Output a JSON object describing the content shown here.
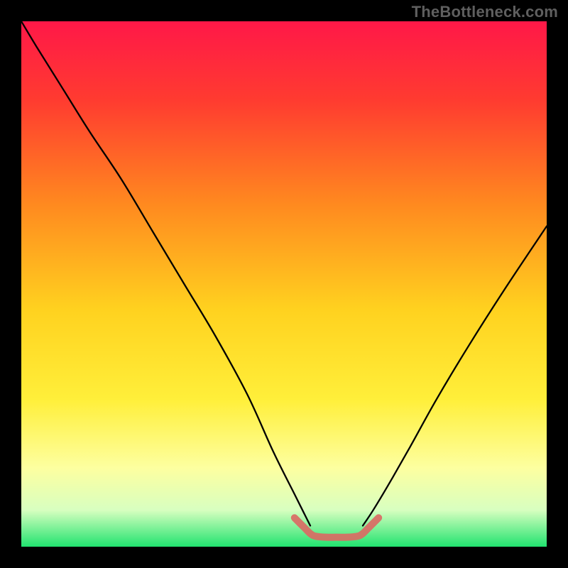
{
  "watermark": {
    "text": "TheBottleneck.com"
  },
  "chart_data": {
    "type": "line",
    "title": "",
    "xlabel": "",
    "ylabel": "",
    "xlim": [
      0,
      100
    ],
    "ylim": [
      0,
      100
    ],
    "background_gradient": {
      "stops": [
        {
          "offset": 0.0,
          "color": "#ff1848"
        },
        {
          "offset": 0.15,
          "color": "#ff3b30"
        },
        {
          "offset": 0.35,
          "color": "#ff8a1f"
        },
        {
          "offset": 0.55,
          "color": "#ffd21f"
        },
        {
          "offset": 0.72,
          "color": "#ffef3a"
        },
        {
          "offset": 0.85,
          "color": "#fdffa0"
        },
        {
          "offset": 0.93,
          "color": "#d8ffc0"
        },
        {
          "offset": 1.0,
          "color": "#21e36f"
        }
      ]
    },
    "series": [
      {
        "name": "left-curve",
        "color": "#000000",
        "x": [
          0,
          3,
          8,
          13,
          19,
          25,
          31,
          37,
          43,
          48,
          52,
          54,
          55
        ],
        "y": [
          100,
          95,
          87,
          79,
          70,
          60,
          50,
          40,
          29,
          18,
          10,
          6,
          4
        ]
      },
      {
        "name": "right-curve",
        "color": "#000000",
        "x": [
          65,
          67,
          70,
          74,
          79,
          85,
          92,
          100
        ],
        "y": [
          4,
          7,
          12,
          19,
          28,
          38,
          49,
          61
        ]
      },
      {
        "name": "valley-outline",
        "color": "#da6a64",
        "x": [
          52,
          54,
          55,
          56,
          58,
          60,
          62,
          64,
          65,
          66,
          68
        ],
        "y": [
          5.5,
          3.5,
          2.5,
          2.0,
          1.8,
          1.8,
          1.8,
          2.0,
          2.5,
          3.5,
          5.5
        ]
      }
    ],
    "annotations": []
  }
}
